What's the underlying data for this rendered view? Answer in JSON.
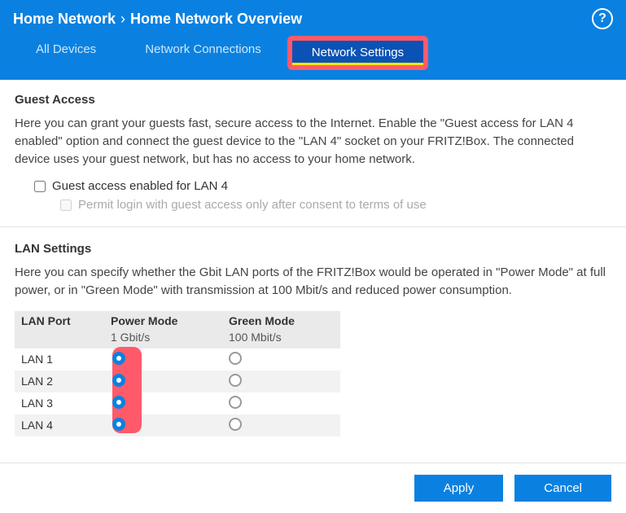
{
  "breadcrumb": {
    "root": "Home Network",
    "page": "Home Network Overview"
  },
  "tabs": {
    "all_devices": "All Devices",
    "network_connections": "Network Connections",
    "network_settings": "Network Settings"
  },
  "guest": {
    "title": "Guest Access",
    "desc": "Here you can grant your guests fast, secure access to the Internet. Enable the \"Guest access for LAN 4 enabled\" option and connect the guest device to the \"LAN 4\" socket on your FRITZ!Box. The connected device uses your guest network, but has no access to your home network.",
    "chk1": "Guest access enabled for LAN 4",
    "chk2": "Permit login with guest access only after consent to terms of use"
  },
  "lan": {
    "title": "LAN Settings",
    "desc": "Here you can specify whether the Gbit LAN ports of the FRITZ!Box would be operated in \"Power Mode\" at full power, or in \"Green Mode\" with transmission at 100 Mbit/s and reduced power consumption.",
    "col_port": "LAN Port",
    "col_power": "Power Mode",
    "col_green": "Green Mode",
    "power_sub": "1 Gbit/s",
    "green_sub": "100 Mbit/s",
    "rows": [
      {
        "port": "LAN 1",
        "mode": "power"
      },
      {
        "port": "LAN 2",
        "mode": "power"
      },
      {
        "port": "LAN 3",
        "mode": "power"
      },
      {
        "port": "LAN 4",
        "mode": "power"
      }
    ]
  },
  "buttons": {
    "apply": "Apply",
    "cancel": "Cancel"
  }
}
